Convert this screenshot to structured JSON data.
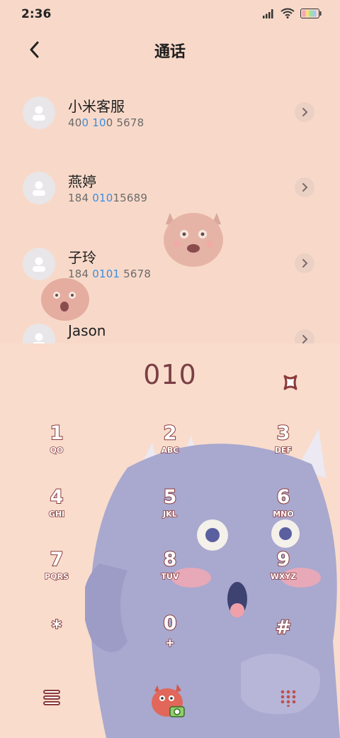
{
  "status": {
    "time": "2:36"
  },
  "header": {
    "title": "通话"
  },
  "contacts": [
    {
      "name": "小米客服",
      "number_parts": [
        "40",
        "0 10",
        "0 5678"
      ]
    },
    {
      "name": "燕婷",
      "number_parts": [
        "184 ",
        "010",
        "15689"
      ]
    },
    {
      "name": "子玲",
      "number_parts": [
        "184 ",
        "0101",
        " 5678"
      ]
    },
    {
      "name": "Jason",
      "number_parts": [
        "",
        "",
        ""
      ]
    }
  ],
  "dialer": {
    "input": "010"
  },
  "keys": [
    {
      "digit": "1",
      "letters": "QO"
    },
    {
      "digit": "2",
      "letters": "ABC"
    },
    {
      "digit": "3",
      "letters": "DEF"
    },
    {
      "digit": "4",
      "letters": "GHI"
    },
    {
      "digit": "5",
      "letters": "JKL"
    },
    {
      "digit": "6",
      "letters": "MNO"
    },
    {
      "digit": "7",
      "letters": "PQRS"
    },
    {
      "digit": "8",
      "letters": "TUV"
    },
    {
      "digit": "9",
      "letters": "WXYZ"
    },
    {
      "digit": "*",
      "letters": ""
    },
    {
      "digit": "0",
      "letters": "+"
    },
    {
      "digit": "#",
      "letters": ""
    }
  ],
  "colors": {
    "background": "#f8d9c9",
    "accent_digit": "#3a8ee0",
    "dial_text": "#7a3f45",
    "key_stroke": "#8a3a3a"
  },
  "icons": {
    "back": "chevron-left-icon",
    "detail": "chevron-right-icon",
    "delete": "backspace-icon",
    "menu": "menu-icon",
    "call": "monster-call-icon",
    "keypad": "dialpad-icon"
  }
}
